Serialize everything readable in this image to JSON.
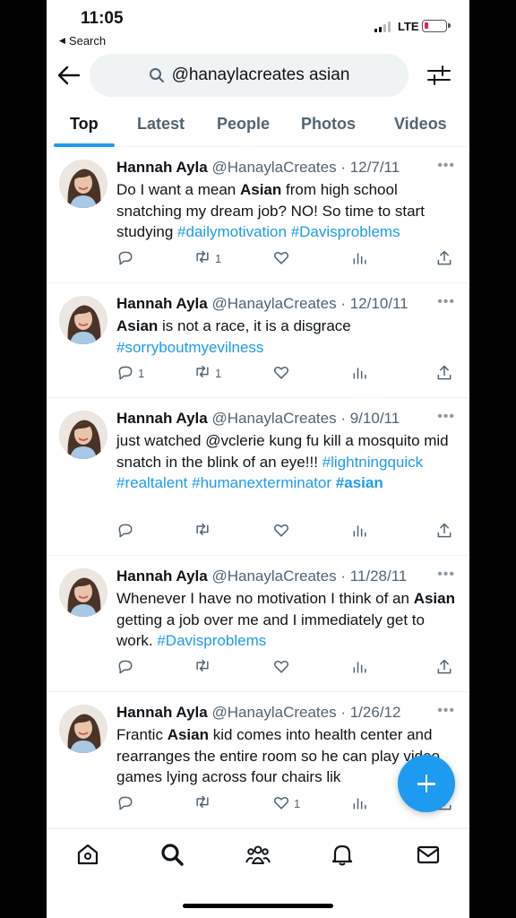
{
  "status_bar": {
    "time": "11:05",
    "back_label": "Search",
    "network": "LTE"
  },
  "header": {
    "search_query": "@hanaylacreates asian"
  },
  "tabs": [
    {
      "label": "Top",
      "active": true
    },
    {
      "label": "Latest",
      "active": false
    },
    {
      "label": "People",
      "active": false
    },
    {
      "label": "Photos",
      "active": false
    },
    {
      "label": "Videos",
      "active": false
    }
  ],
  "tweets": [
    {
      "name": "Hannah Ayla",
      "handle": "@HanaylaCreates",
      "date": "· 12/7/11",
      "text_segments": [
        {
          "t": "Do I want a mean "
        },
        {
          "t": "Asian",
          "b": true
        },
        {
          "t": " from high school snatching my dream job? NO! So time to start studying "
        },
        {
          "t": "#dailymotivation",
          "tag": true
        },
        {
          "t": " "
        },
        {
          "t": "#Davisproblems",
          "tag": true
        }
      ],
      "replies": "",
      "retweets": "1",
      "likes": ""
    },
    {
      "name": "Hannah Ayla",
      "handle": "@HanaylaCreates",
      "date": "· 12/10/11",
      "text_segments": [
        {
          "t": "Asian",
          "b": true
        },
        {
          "t": " is not a race, it is a disgrace "
        },
        {
          "t": "#sorryboutmyevilness",
          "tag": true
        }
      ],
      "replies": "1",
      "retweets": "1",
      "likes": ""
    },
    {
      "name": "Hannah Ayla",
      "handle": "@HanaylaCreates",
      "date": "· 9/10/11",
      "text_segments": [
        {
          "t": "just watched @vclerie kung fu kill a mosquito mid snatch in the blink of an eye!!! "
        },
        {
          "t": "#lightningquick",
          "tag": true
        },
        {
          "t": " "
        },
        {
          "t": "#realtalent",
          "tag": true
        },
        {
          "t": " "
        },
        {
          "t": "#humanexterminator",
          "tag": true
        },
        {
          "t": " "
        },
        {
          "t": "#asian",
          "tag": true,
          "b": true
        }
      ],
      "replies": "",
      "retweets": "",
      "likes": ""
    },
    {
      "name": "Hannah Ayla",
      "handle": "@HanaylaCreates",
      "date": "· 11/28/11",
      "text_segments": [
        {
          "t": "Whenever I have no motivation I think of an "
        },
        {
          "t": "Asian",
          "b": true
        },
        {
          "t": " getting a job over me and I immediately get to work. "
        },
        {
          "t": "#Davisproblems",
          "tag": true
        }
      ],
      "replies": "",
      "retweets": "",
      "likes": ""
    },
    {
      "name": "Hannah Ayla",
      "handle": "@HanaylaCreates",
      "date": "· 1/26/12",
      "text_segments": [
        {
          "t": "Frantic "
        },
        {
          "t": "Asian",
          "b": true
        },
        {
          "t": " kid comes into health center and rearranges the entire room so he can play video games lying across four chairs lik"
        }
      ],
      "replies": "",
      "retweets": "",
      "likes": "1"
    }
  ],
  "colors": {
    "accent": "#1d9bf0",
    "secondary_text": "#536471",
    "text": "#0f1419"
  }
}
